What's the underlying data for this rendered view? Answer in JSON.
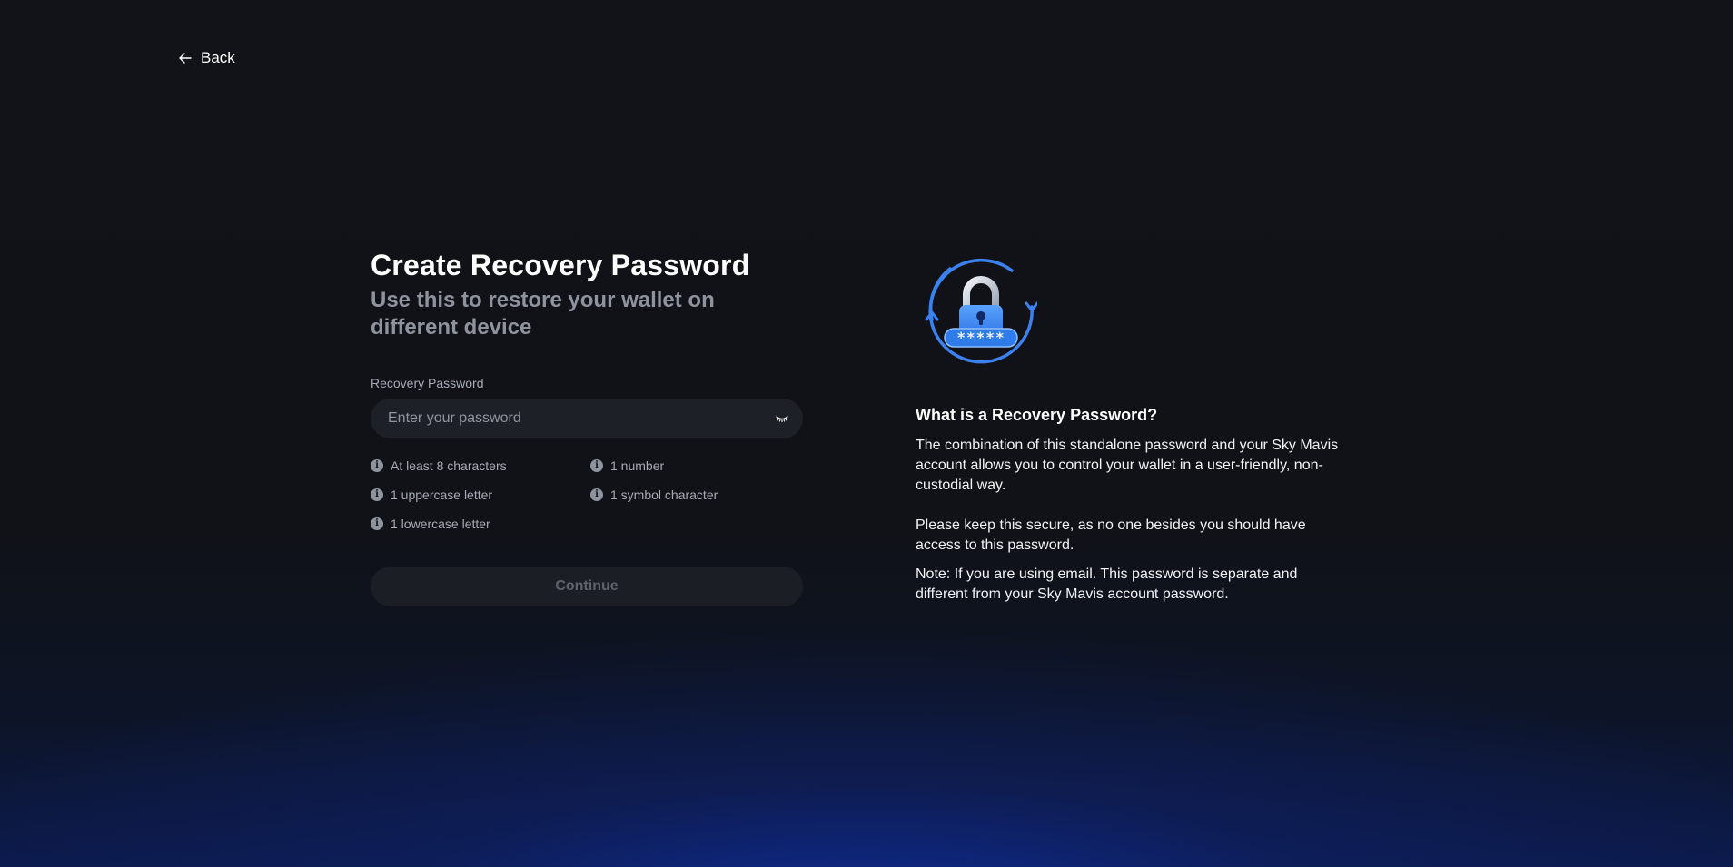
{
  "nav": {
    "back_label": "Back"
  },
  "form": {
    "title": "Create Recovery Password",
    "subtitle": "Use this to restore your wallet on different device",
    "field_label": "Recovery Password",
    "password_placeholder": "Enter your password",
    "password_value": "",
    "requirements": [
      {
        "label": "At least 8 characters",
        "icon": "info-icon"
      },
      {
        "label": "1 number",
        "icon": "info-icon"
      },
      {
        "label": "1 uppercase letter",
        "icon": "info-icon"
      },
      {
        "label": "1 symbol character",
        "icon": "info-icon"
      },
      {
        "label": "1 lowercase letter",
        "icon": "info-icon"
      }
    ],
    "continue_label": "Continue",
    "continue_disabled": true
  },
  "info": {
    "heading": "What is a Recovery Password?",
    "paragraph_1": "The combination of this standalone password and your Sky Mavis account allows you to control your wallet in a user-friendly, non-custodial way.",
    "paragraph_2": "Please keep this secure, as no one besides you should have access to this password.",
    "paragraph_3": "Note: If you are using email. This password is separate and different from your Sky Mavis account password.",
    "illustration": "lock-with-password-refresh-icon",
    "illustration_mask": "*****"
  },
  "colors": {
    "background": "#111318",
    "accent_blue": "#3b82f0",
    "muted_text": "#8e939d",
    "input_bg": "#1d2027"
  }
}
